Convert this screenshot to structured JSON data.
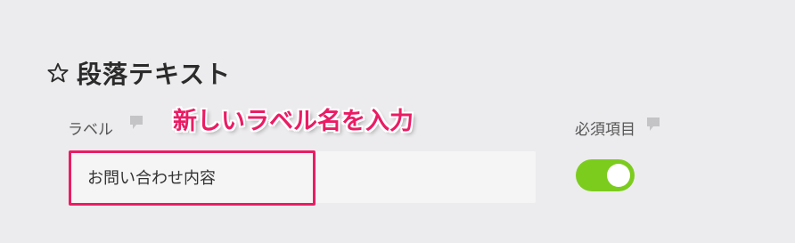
{
  "section": {
    "title": "段落テキスト",
    "icon": "star-outline-icon"
  },
  "label_field": {
    "label": "ラベル",
    "comment_icon": "comment-icon",
    "value": "お問い合わせ内容"
  },
  "annotation": {
    "text": "新しいラベル名を入力",
    "color": "#ea1c64"
  },
  "required_field": {
    "label": "必須項目",
    "comment_icon": "comment-icon",
    "toggle_on": true,
    "toggle_color": "#7ccc1e"
  }
}
